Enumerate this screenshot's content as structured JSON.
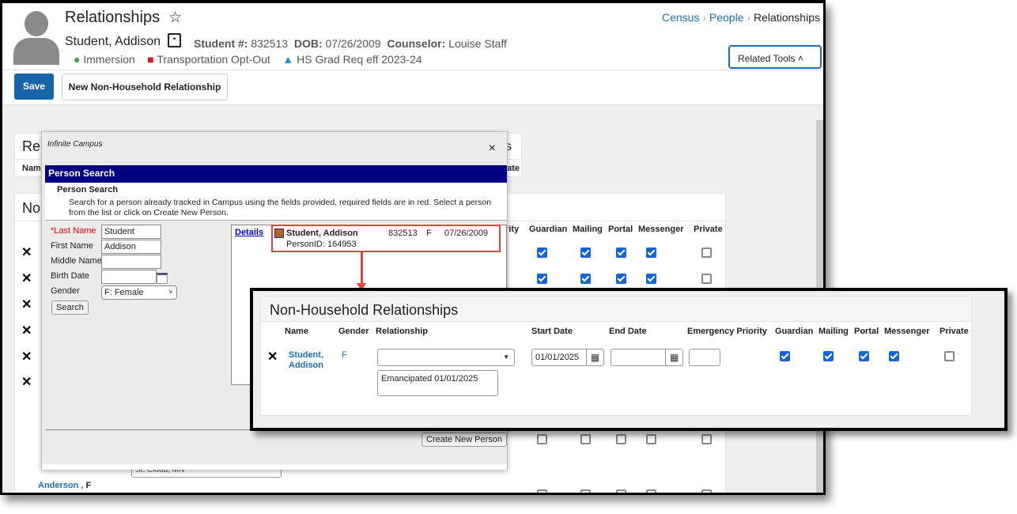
{
  "header": {
    "title": "Relationships",
    "student_name": "Student, Addison",
    "student_num_label": "Student #:",
    "student_num": "832513",
    "dob_label": "DOB:",
    "dob": "07/26/2009",
    "counselor_label": "Counselor:",
    "counselor": "Louise Staff",
    "flags": [
      "Immersion",
      "Transportation Opt-Out",
      "HS Grad Req eff 2023-24"
    ]
  },
  "breadcrumb": [
    "Census",
    "People",
    "Relationships"
  ],
  "related_tools": "Related Tools",
  "toolbar": {
    "save": "Save",
    "new_rel": "New Non-Household Relationship"
  },
  "background": {
    "section1_title": "Re",
    "section1_col": "Nam",
    "section1_col_right": "ate",
    "section1_title_right": "s",
    "section2_title": "No",
    "cols": [
      "rity",
      "Guardian",
      "Mailing",
      "Portal",
      "Messenger",
      "Private"
    ],
    "row_last_name": "Anderson ,",
    "row_last_gender": "F",
    "address_fragment": "St. Cloud, MN"
  },
  "dialog": {
    "logo": "Infinite Campus",
    "title": "Person Search",
    "subtitle": "Person Search",
    "description": "Search for a person already tracked in Campus using the fields provided, required fields are in red. Select a person from the list or click on Create New Person.",
    "fields": {
      "last_name_label": "*Last Name",
      "last_name": "Student",
      "first_name_label": "First Name",
      "first_name": "Addison",
      "middle_name_label": "Middle Name",
      "middle_name": "",
      "birth_date_label": "Birth Date",
      "birth_date": "",
      "gender_label": "Gender",
      "gender": "F: Female"
    },
    "search": "Search",
    "details": "Details",
    "result": {
      "name": "Student, Addison",
      "id": "832513",
      "gender": "F",
      "dob": "07/26/2009",
      "person_id": "PersonID: 164953"
    },
    "create": "Create New Person",
    "close": "×"
  },
  "callout": {
    "title": "Non-Household Relationships",
    "cols": [
      "Name",
      "Gender",
      "Relationship",
      "Start Date",
      "End Date",
      "Emergency Priority",
      "Guardian",
      "Mailing",
      "Portal",
      "Messenger",
      "Private"
    ],
    "row": {
      "name": "Student, Addison",
      "gender": "F",
      "relationship": "",
      "comment": "Emancipated 01/01/2025",
      "start_date": "01/01/2025",
      "end_date": "",
      "priority": "",
      "guardian": true,
      "mailing": true,
      "portal": true,
      "messenger": true,
      "private": false
    }
  },
  "colors": {
    "accent": "#1a6fb5",
    "save": "#1565a8",
    "dialog_title": "#000080",
    "highlight": "#e8403f"
  }
}
